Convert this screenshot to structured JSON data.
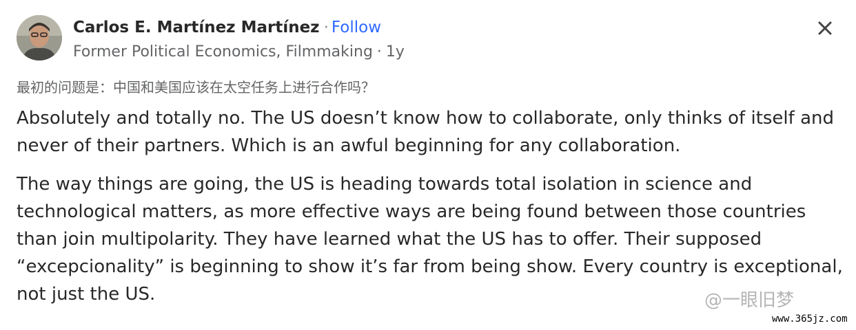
{
  "author": {
    "name": "Carlos E. Martínez Martínez",
    "separator": "·",
    "follow_label": "Follow",
    "credential": "Former Political Economics, Filmmaking",
    "time_dot": "·",
    "time": "1y"
  },
  "question": "最初的问题是：中国和美国应该在太空任务上进行合作吗？",
  "answer": {
    "paragraphs": [
      "Absolutely and totally no. The US doesn’t know how to collaborate, only thinks of itself and never of their partners. Which is an awful beginning for any collaboration.",
      "The way things are going, the US is heading towards total isolation in science and technological matters, as more effective ways are being found between those countries than join multipolarity. They have learned what the US has to offer. Their supposed “excepcionality” is beginning to show it’s far from being show. Every country is exceptional, not just the US."
    ]
  },
  "watermark": {
    "text": "@一眼旧梦",
    "site": "www.365jz.com"
  },
  "icons": {
    "close": "close-icon",
    "avatar": "avatar"
  }
}
